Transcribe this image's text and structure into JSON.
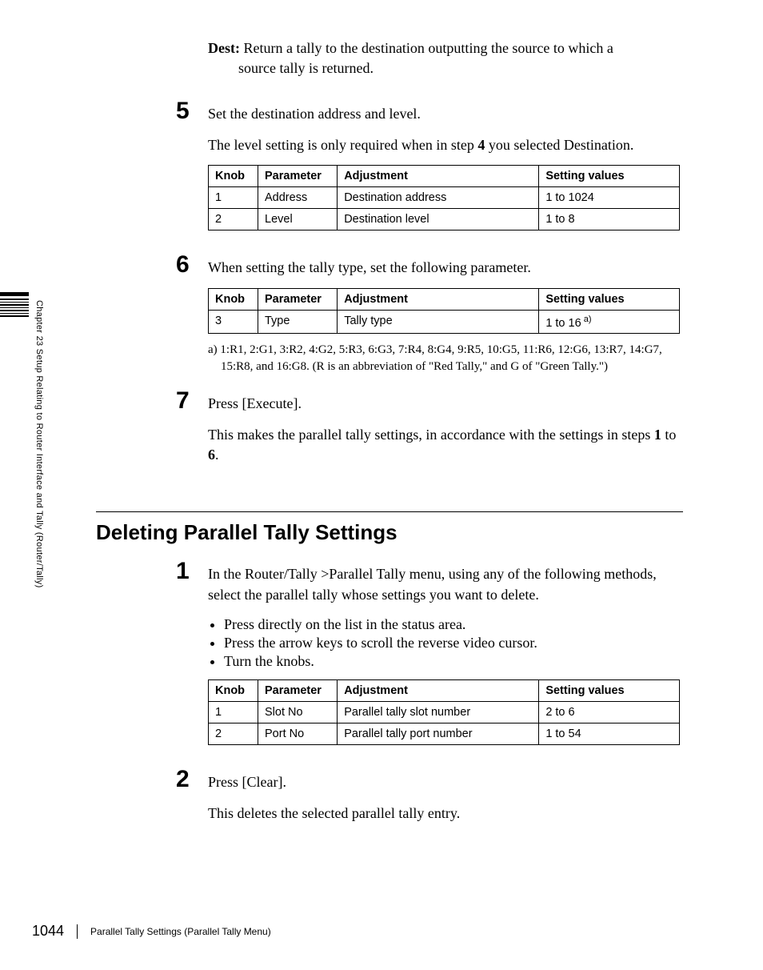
{
  "sideLabel": "Chapter 23  Setup Relating to Router Interface and Tally (Router/Tally)",
  "destBold": "Dest:",
  "destText1": " Return a tally to the destination outputting the source to which a",
  "destText2": "source tally is returned.",
  "steps": {
    "s5": {
      "num": "5",
      "line1": "Set the destination address and level.",
      "line2a": "The level setting is only required when in step ",
      "line2bold": "4",
      "line2b": " you selected Destination."
    },
    "s6": {
      "num": "6",
      "line1": "When setting the tally type, set the following parameter."
    },
    "s7": {
      "num": "7",
      "line1": "Press [Execute].",
      "line2a": "This makes the parallel tally settings, in accordance with the settings in steps ",
      "line2b1": "1",
      "line2mid": " to ",
      "line2b2": "6",
      "line2end": "."
    },
    "d1": {
      "num": "1",
      "line1": "In the Router/Tally >Parallel Tally menu, using any of the following methods, select the parallel tally whose settings you want to delete."
    },
    "d2": {
      "num": "2",
      "line1": "Press [Clear].",
      "line2": "This deletes the selected parallel tally entry."
    }
  },
  "tableHeaders": {
    "knob": "Knob",
    "parameter": "Parameter",
    "adjustment": "Adjustment",
    "settingValues": "Setting values"
  },
  "table1": [
    {
      "knob": "1",
      "param": "Address",
      "adj": "Destination address",
      "set": "1 to 1024"
    },
    {
      "knob": "2",
      "param": "Level",
      "adj": "Destination level",
      "set": "1 to 8"
    }
  ],
  "table2": [
    {
      "knob": "3",
      "param": "Type",
      "adj": "Tally type",
      "set": "1 to 16",
      "setSup": " a)"
    }
  ],
  "footnote": "a) 1:R1, 2:G1, 3:R2, 4:G2, 5:R3, 6:G3, 7:R4, 8:G4, 9:R5, 10:G5, 11:R6, 12:G6, 13:R7, 14:G7, 15:R8, and 16:G8. (R is an abbreviation of \"Red Tally,\" and G of \"Green Tally.\")",
  "sectionTitle": "Deleting Parallel Tally Settings",
  "bullets": [
    "Press directly on the list in the status area.",
    "Press the arrow keys to scroll the reverse video cursor.",
    "Turn the knobs."
  ],
  "table3": [
    {
      "knob": "1",
      "param": "Slot No",
      "adj": "Parallel tally slot number",
      "set": "2 to 6"
    },
    {
      "knob": "2",
      "param": "Port No",
      "adj": "Parallel tally port number",
      "set": "1 to 54"
    }
  ],
  "footer": {
    "pageNum": "1044",
    "text": "Parallel Tally Settings (Parallel Tally Menu)"
  }
}
